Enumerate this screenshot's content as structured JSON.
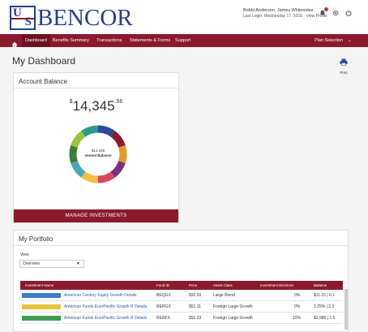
{
  "header": {
    "brand": "BENCOR",
    "logo_letters": [
      "U",
      "S"
    ],
    "user_line1": "Bobbi Anderson, James Whitesides",
    "user_line2": "Last Login: Wednesday 17, 2015 · View Profile",
    "icons": [
      "bell-icon",
      "gear-icon",
      "logout-icon"
    ]
  },
  "nav": {
    "items": [
      {
        "label": "Dashboard",
        "active": true
      },
      {
        "label": "Benefits Summary"
      },
      {
        "label": "Transactions"
      },
      {
        "label": "Statements & Forms"
      },
      {
        "label": "Support"
      }
    ],
    "plan_label": "Plan Selection"
  },
  "page": {
    "title": "My Dashboard",
    "print_label": "Print"
  },
  "balance": {
    "card_title": "Account Balance",
    "currency": "$",
    "amount_main": "14,345",
    "amount_cents": ".56",
    "donut_value": "$14,345",
    "donut_label": "Vested Balance",
    "manage_label": "MANAGE INVESTMENTS",
    "donut_colors": [
      "#2c4a9a",
      "#8b1a2b",
      "#e59a2a",
      "#7b2f7d",
      "#d64560",
      "#f2c043",
      "#4aa8b9",
      "#3d7d3a",
      "#9bc23c",
      "#2d9b8a"
    ]
  },
  "portfolio": {
    "card_title": "My Portfolio",
    "view_label": "View",
    "view_value": "Overview",
    "columns": [
      "Investment Name",
      "Fund ID",
      "Price",
      "Asset Class",
      "Investment Elections",
      "Balance"
    ],
    "rows": [
      {
        "name": "American Century Equity Growth Details",
        "fund_id": "BEQGX",
        "price": "$32.03",
        "asset_class": "Large Blend",
        "elections": "0%",
        "balance": "$11.15 | 0.1",
        "bar_color": "#3d7dc9"
      },
      {
        "name": "American Funds EuroPacific Growth R Details",
        "fund_id": "RERGX",
        "price": "$51.11",
        "asset_class": "Foreign Large Growth",
        "elections": "0%",
        "balance": "2.25% | 2.3",
        "bar_color": "#e6c23a"
      },
      {
        "name": "American Funds EuroPacific Growth R Details",
        "fund_id": "RERFX",
        "price": "$51.23",
        "asset_class": "Foreign Large Growth",
        "elections": "10%",
        "balance": "$2,985 | 1.5",
        "bar_color": "#3d9d55"
      }
    ]
  }
}
